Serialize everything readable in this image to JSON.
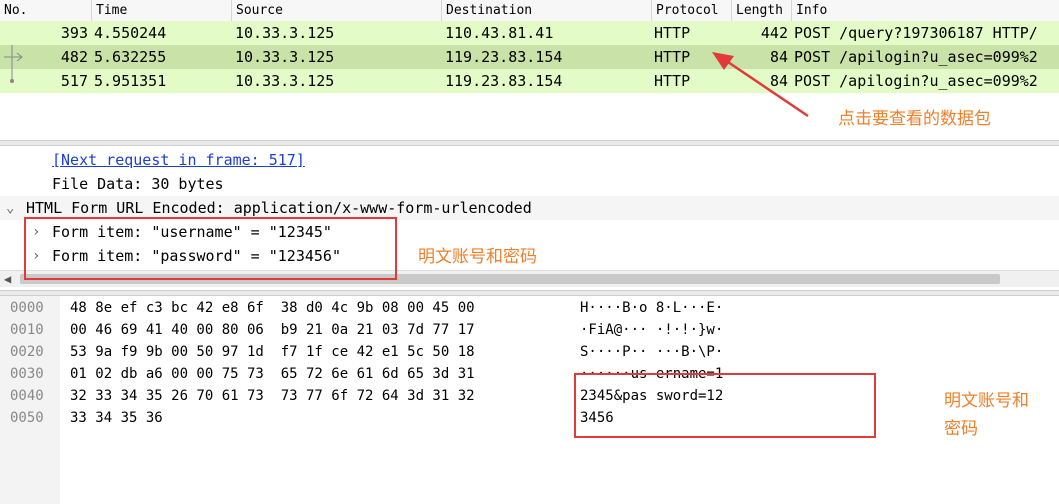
{
  "packet_list": {
    "headers": [
      "No.",
      "Time",
      "Source",
      "Destination",
      "Protocol",
      "Length",
      "Info"
    ],
    "rows": [
      {
        "no": "393",
        "time": "4.550244",
        "source": "10.33.3.125",
        "destination": "110.43.81.41",
        "protocol": "HTTP",
        "length": "442",
        "info": "POST /query?197306187 HTTP/"
      },
      {
        "no": "482",
        "time": "5.632255",
        "source": "10.33.3.125",
        "destination": "119.23.83.154",
        "protocol": "HTTP",
        "length": "84",
        "info": "POST /apilogin?u_asec=099%2"
      },
      {
        "no": "517",
        "time": "5.951351",
        "source": "10.33.3.125",
        "destination": "119.23.83.154",
        "protocol": "HTTP",
        "length": "84",
        "info": "POST /apilogin?u_asec=099%2"
      }
    ]
  },
  "details": {
    "next_request": "[Next request in frame: 517]",
    "file_data": "File Data: 30 bytes",
    "html_form": "HTML Form URL Encoded: application/x-www-form-urlencoded",
    "items": [
      "Form item: \"username\" = \"12345\"",
      "Form item: \"password\" = \"123456\""
    ]
  },
  "bytes": {
    "offsets": [
      "0000",
      "0010",
      "0020",
      "0030",
      "0040",
      "0050"
    ],
    "hex": [
      "48 8e ef c3 bc 42 e8 6f  38 d0 4c 9b 08 00 45 00",
      "00 46 69 41 40 00 80 06  b9 21 0a 21 03 7d 77 17",
      "53 9a f9 9b 00 50 97 1d  f7 1f ce 42 e1 5c 50 18",
      "01 02 db a6 00 00 75 73  65 72 6e 61 6d 65 3d 31",
      "32 33 34 35 26 70 61 73  73 77 6f 72 64 3d 31 32",
      "33 34 35 36"
    ],
    "ascii": [
      "H····B·o 8·L···E·",
      "·FiA@··· ·!·!·}w·",
      "S····P·· ···B·\\P·",
      "······us ername=1",
      "2345&pas sword=12",
      "3456"
    ]
  },
  "annotations": {
    "packet_hint": "点击要查看的数据包",
    "form_hint": "明文账号和密码",
    "bytes_hint_line1": "明文账号和",
    "bytes_hint_line2": "密码"
  },
  "colors": {
    "row_light": "#e3fbc6",
    "row_selected": "#c9e2a7",
    "annotation": "#f07f2a",
    "highlight_box": "#e23a3a",
    "link": "#1a3fd9"
  }
}
